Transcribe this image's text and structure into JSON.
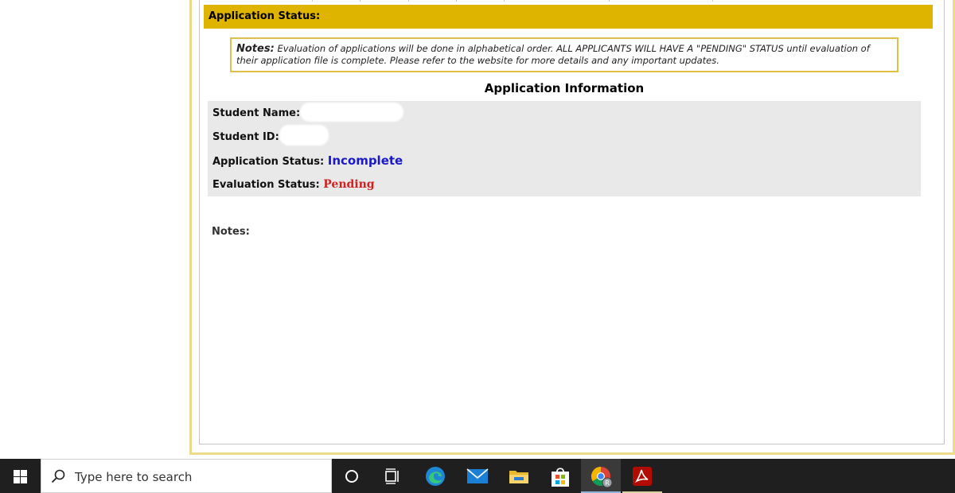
{
  "header": {
    "title": "Application Status:"
  },
  "notes_box": {
    "label": "Notes:",
    "text": "Evaluation of applications will be done in alphabetical order. ALL APPLICANTS WILL HAVE A \"PENDING\" STATUS until evaluation of their application file is complete. Please refer to the website for more details and any important updates."
  },
  "info": {
    "title": "Application Information",
    "student_name_label": "Student Name:",
    "student_id_label": "Student ID:",
    "application_status_label": "Application Status:",
    "application_status_value": "Incomplete",
    "evaluation_status_label": "Evaluation Status:",
    "evaluation_status_value": "Pending"
  },
  "notes_section": {
    "label": "Notes:"
  },
  "taskbar": {
    "search_placeholder": "Type here to search",
    "icons": [
      "windows-start-icon",
      "search-icon",
      "cortana-icon",
      "task-view-icon",
      "edge-icon",
      "mail-icon",
      "file-explorer-icon",
      "store-icon",
      "chrome-icon",
      "acrobat-icon"
    ]
  },
  "colors": {
    "header_bg": "#dfb400",
    "incomplete": "#1a1ac8",
    "pending": "#d42020"
  }
}
